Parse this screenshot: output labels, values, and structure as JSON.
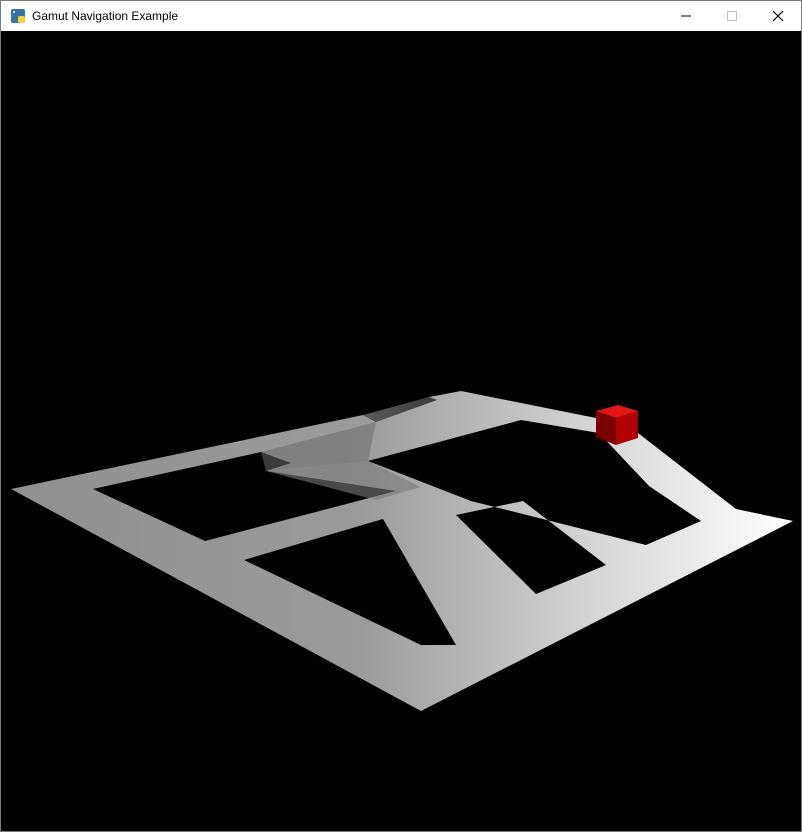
{
  "window": {
    "title": "Gamut Navigation Example",
    "icon": "python-icon",
    "controls": [
      "minimize",
      "maximize",
      "close"
    ]
  },
  "scene": {
    "background_color": "#000000",
    "floor_color": "#ffffff",
    "agent": {
      "name": "red-cube",
      "color": "#cc0000"
    }
  }
}
